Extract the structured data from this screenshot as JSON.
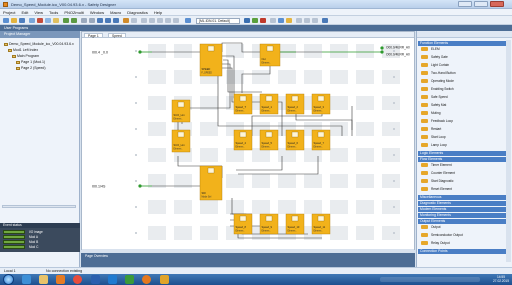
{
  "window": {
    "title": "Demo_Speed_Module.ico_V00.04.93.6.x - Safety Designer",
    "min_icon": "minimize-icon",
    "max_icon": "maximize-icon",
    "close_icon": "close-icon"
  },
  "menu": [
    "Project",
    "Edit",
    "View",
    "Tools",
    "PNOZmulti",
    "Window",
    "Macro",
    "Diagnostics",
    "Help"
  ],
  "toolbar": {
    "selected": "[ML.IDN.01. Default]"
  },
  "subtitle": "User Programs",
  "left": {
    "tab": "Project Manager",
    "tree": [
      "Demo_Speed_Module_ico_V00.04.93.6.x",
      "Mod1 Left Index",
      "Main Program",
      "Page 1 (Mod.1)",
      "Page 2 (Speed)"
    ],
    "status_header": "Event status",
    "status_items": [
      "I/O image",
      "Mod A",
      "Mod B",
      "Mod C"
    ]
  },
  "canvas": {
    "tabs": [
      "Page 1",
      "Speed"
    ],
    "inputs": [
      "I00.4 _0.0",
      "I00.1/4S"
    ],
    "outputs": [
      "O00.0/4ERR_A0",
      "O00.0/4ERR_A0"
    ],
    "blocks": [
      {
        "id": "bl1",
        "label": "SPEED",
        "sub": "F_SPEED"
      },
      {
        "id": "bl2",
        "label": "Out",
        "sub": "Elemen.."
      },
      {
        "id": "bl3",
        "label": "SCO_Lim",
        "sub": "Elemen.."
      },
      {
        "id": "bl4",
        "label": "Speed_T",
        "sub": "Elemen.."
      },
      {
        "id": "bl5",
        "label": "Speed_1",
        "sub": "Elemen.."
      },
      {
        "id": "bl6",
        "label": "Speed_2",
        "sub": "Elemen.."
      },
      {
        "id": "bl7",
        "label": "Speed_3",
        "sub": "Elemen.."
      },
      {
        "id": "bl8",
        "label": "SCO_Lim",
        "sub": "Elemen.."
      },
      {
        "id": "bl9",
        "label": "Speed_4",
        "sub": "Elemen.."
      },
      {
        "id": "bl10",
        "label": "Speed_5",
        "sub": "Elemen.."
      },
      {
        "id": "bl11",
        "label": "Speed_6",
        "sub": "Elemen.."
      },
      {
        "id": "bl12",
        "label": "Speed_7",
        "sub": "Elemen.."
      },
      {
        "id": "bl13",
        "label": "SDI",
        "sub": "Mode Sel"
      },
      {
        "id": "bl14",
        "label": "Speed_8",
        "sub": "Elemen.."
      },
      {
        "id": "bl15",
        "label": "Speed_9",
        "sub": "Elemen.."
      },
      {
        "id": "bl16",
        "label": "Speed_10",
        "sub": "Elemen.."
      },
      {
        "id": "bl17",
        "label": "Speed_11",
        "sub": "Elemen.."
      }
    ],
    "outline_label": "Page Overview"
  },
  "right": {
    "sections": [
      {
        "name": "Function Elements",
        "items": [
          "ELEM",
          "Safety Gate",
          "Light Curtain",
          "Two-Hand Button",
          "Operating Mode",
          "Enabling Switch",
          "Safe Speed",
          "Safety Mat",
          "Muting",
          "Feedback Loop",
          "Restart",
          "Start Loop",
          "Lamp Loop"
        ]
      },
      {
        "name": "Logic Elements",
        "items": []
      },
      {
        "name": "Flow Elements",
        "items": [
          "Timer Element",
          "Counter Element",
          "Start Diagnostic",
          "Reset Element"
        ]
      },
      {
        "name": "Miscellaneous",
        "items": []
      },
      {
        "name": "Diagnostic Elements",
        "items": []
      },
      {
        "name": "Modem Elements",
        "items": []
      },
      {
        "name": "Monitoring Elements",
        "items": []
      },
      {
        "name": "Output Elements",
        "items": [
          "Output",
          "Semiconductor Output",
          "Relay Output"
        ]
      },
      {
        "name": "Connection Points",
        "items": []
      }
    ],
    "colors": {
      "header": "#4a7ec5",
      "item_fill": "#e6a72a"
    }
  },
  "status": {
    "left": "Local 1",
    "message": "No connection existing"
  },
  "taskbar": {
    "icons": [
      "ie-icon",
      "explorer-icon",
      "media-icon",
      "chrome-icon",
      "word-icon",
      "outlook-icon",
      "excel-icon",
      "firefox-icon",
      "paint-icon"
    ],
    "time": "14:55",
    "date": "27.02.2015"
  }
}
